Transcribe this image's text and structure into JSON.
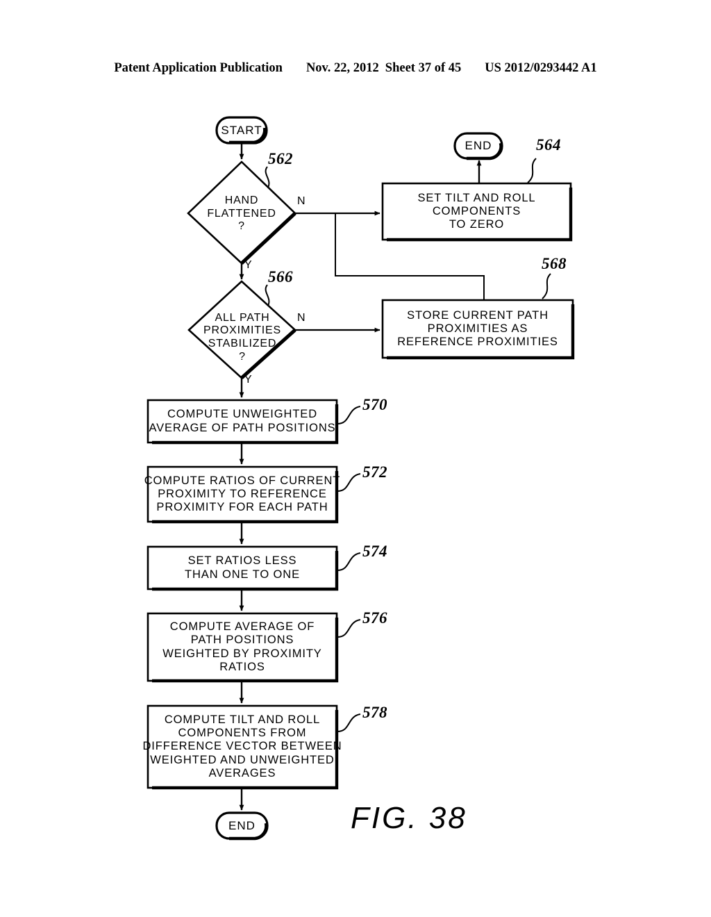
{
  "header": {
    "publication": "Patent Application Publication",
    "date": "Nov. 22, 2012",
    "sheet": "Sheet 37 of 45",
    "document_number": "US 2012/0293442 A1"
  },
  "figure": {
    "caption": "FIG.  38",
    "title": "FIG. 38"
  },
  "flowchart": {
    "nodes": {
      "start": {
        "label": "START",
        "shape": "terminator"
      },
      "end_top": {
        "label": "END",
        "shape": "terminator"
      },
      "end_bottom": {
        "label": "END",
        "shape": "terminator"
      },
      "decision_562": {
        "ref": "562",
        "shape": "decision",
        "lines": [
          "HAND",
          "FLATTENED",
          "?"
        ]
      },
      "process_564": {
        "ref": "564",
        "shape": "process",
        "lines": [
          "SET TILT AND ROLL",
          "COMPONENTS",
          "TO ZERO"
        ]
      },
      "decision_566": {
        "ref": "566",
        "shape": "decision",
        "lines": [
          "ALL PATH",
          "PROXIMITIES",
          "STABILIZED",
          "?"
        ]
      },
      "process_568": {
        "ref": "568",
        "shape": "process",
        "lines": [
          "STORE CURRENT PATH",
          "PROXIMITIES AS",
          "REFERENCE PROXIMITIES"
        ]
      },
      "process_570": {
        "ref": "570",
        "shape": "process",
        "lines": [
          "COMPUTE UNWEIGHTED",
          "AVERAGE OF PATH POSITIONS"
        ]
      },
      "process_572": {
        "ref": "572",
        "shape": "process",
        "lines": [
          "COMPUTE RATIOS OF CURRENT",
          "PROXIMITY TO REFERENCE",
          "PROXIMITY FOR EACH PATH"
        ]
      },
      "process_574": {
        "ref": "574",
        "shape": "process",
        "lines": [
          "SET RATIOS LESS",
          "THAN ONE TO ONE"
        ]
      },
      "process_576": {
        "ref": "576",
        "shape": "process",
        "lines": [
          "COMPUTE AVERAGE OF",
          "PATH POSITIONS",
          "WEIGHTED BY PROXIMITY",
          "RATIOS"
        ]
      },
      "process_578": {
        "ref": "578",
        "shape": "process",
        "lines": [
          "COMPUTE TILT AND ROLL",
          "COMPONENTS FROM",
          "DIFFERENCE VECTOR BETWEEN",
          "WEIGHTED AND UNWEIGHTED",
          "AVERAGES"
        ]
      }
    },
    "branch_labels": {
      "d562_no": "N",
      "d562_yes": "Y",
      "d566_no": "N",
      "d566_yes": "Y"
    },
    "colors": {
      "line": "#000000",
      "fill": "#ffffff",
      "text": "#000000"
    }
  }
}
